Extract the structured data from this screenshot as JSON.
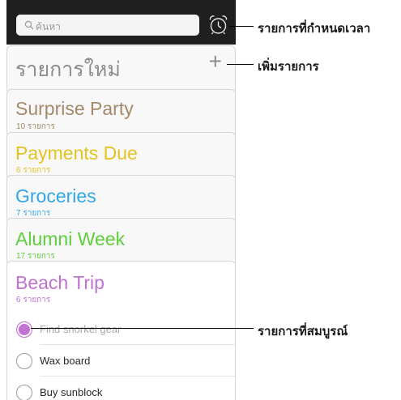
{
  "search": {
    "placeholder": "ค้นหา"
  },
  "new_list": {
    "label": "รายการใหม่",
    "add_symbol": "+"
  },
  "lists": [
    {
      "title": "Surprise Party",
      "count": "10 รายการ",
      "color": "#a28a6a"
    },
    {
      "title": "Payments Due",
      "count": "6 รายการ",
      "color": "#e3c321"
    },
    {
      "title": "Groceries",
      "count": "7 รายการ",
      "color": "#31a7e2"
    },
    {
      "title": "Alumni Week",
      "count": "17 รายการ",
      "color": "#5fce3c"
    },
    {
      "title": "Beach Trip",
      "count": "6 รายการ",
      "color": "#c172d4"
    }
  ],
  "items": [
    {
      "text": "Find snorkel gear",
      "completed": true
    },
    {
      "text": "Wax board",
      "completed": false
    },
    {
      "text": "Buy sunblock",
      "completed": false
    }
  ],
  "callouts": {
    "scheduled": "รายการที่กำหนดเวลา",
    "add_list": "เพิ่มรายการ",
    "completed": "รายการที่สมบูรณ์"
  },
  "icons": {
    "search": "search-icon",
    "alarm": "alarm-clock-icon",
    "add": "plus-icon"
  }
}
